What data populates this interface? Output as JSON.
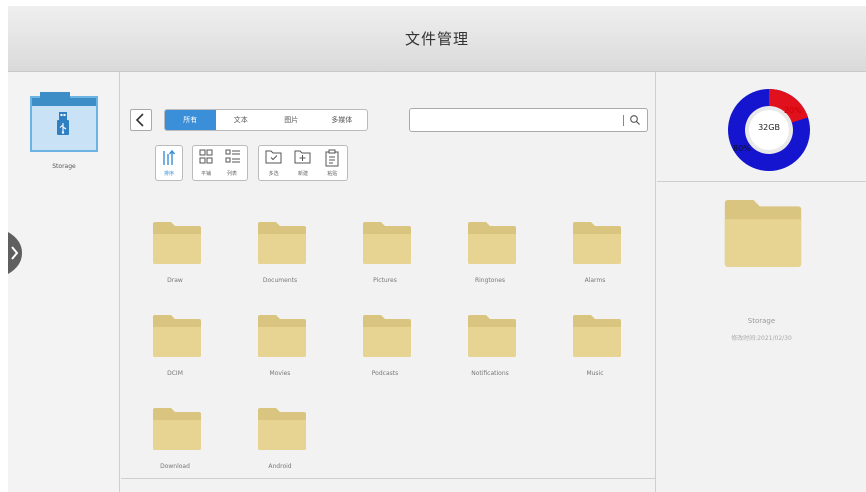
{
  "window": {
    "title": "文件管理"
  },
  "sidebar": {
    "storage_label": "Storage"
  },
  "nav": {
    "tabs": [
      {
        "label": "所有",
        "active": true
      },
      {
        "label": "文本",
        "active": false
      },
      {
        "label": "图片",
        "active": false
      },
      {
        "label": "多媒体",
        "active": false
      }
    ]
  },
  "search": {
    "placeholder": "",
    "value": ""
  },
  "toolbar": {
    "sort_label": "排序",
    "tile_label": "平铺",
    "list_label": "列表",
    "multi_label": "多选",
    "new_label": "新建",
    "paste_label": "粘贴"
  },
  "folders": [
    "Draw",
    "Documents",
    "Pictures",
    "Ringtones",
    "Alarms",
    "DCIM",
    "Movies",
    "Podcasts",
    "Notifications",
    "Music",
    "Download",
    "Android"
  ],
  "storage_chart": {
    "capacity": "32GB",
    "used_label": "20%",
    "free_label": "80%",
    "used_percent": 20,
    "used_color": "#e0101c",
    "free_color": "#1515cf"
  },
  "details": {
    "name": "Storage",
    "modified": "修改时间:2021/02/30"
  },
  "colors": {
    "accent": "#3a8fd8",
    "folder": "#e7d493"
  }
}
